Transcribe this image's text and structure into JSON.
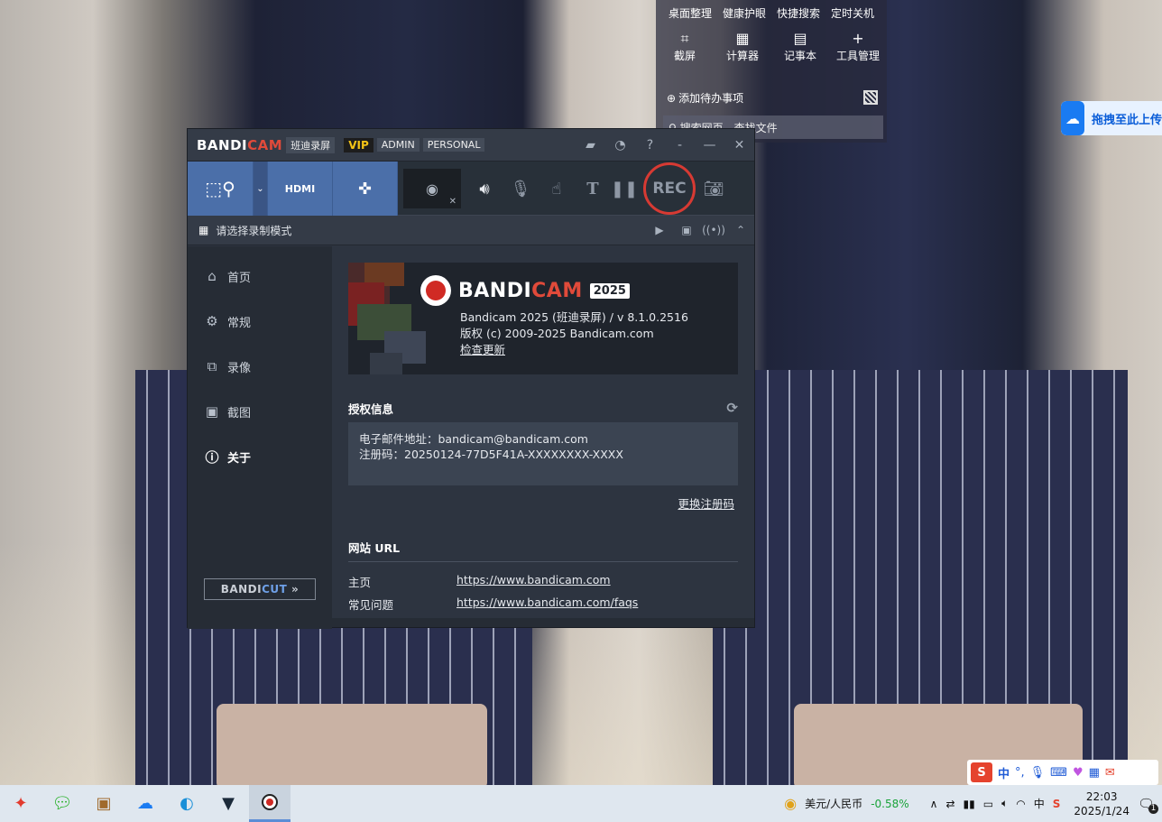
{
  "desktop_widget": {
    "top_links": [
      "桌面整理",
      "健康护眼",
      "快捷搜索",
      "定时关机"
    ],
    "tools": [
      {
        "icon": "crop-icon",
        "label": "截屏"
      },
      {
        "icon": "calculator-icon",
        "label": "计算器"
      },
      {
        "icon": "notepad-icon",
        "label": "记事本"
      },
      {
        "icon": "plus-icon",
        "label": "工具管理"
      }
    ],
    "todo_label": "添加待办事项",
    "search_label": "搜索网页、查找文件"
  },
  "cloud_button": {
    "label": "拖拽至此上传"
  },
  "bandicam": {
    "title": {
      "logo_a": "BANDI",
      "logo_b": "CAM",
      "subtitle": "班迪录屏",
      "vip": "VIP",
      "admin": "ADMIN",
      "personal": "PERSONAL"
    },
    "toolbar": {
      "rec_label": "REC"
    },
    "mode_bar": {
      "label": "请选择录制模式"
    },
    "nav": [
      {
        "icon": "home-icon",
        "label": "首页"
      },
      {
        "icon": "gear-icon",
        "label": "常规"
      },
      {
        "icon": "video-icon",
        "label": "录像"
      },
      {
        "icon": "image-icon",
        "label": "截图"
      },
      {
        "icon": "info-icon",
        "label": "关于"
      }
    ],
    "bandicut": {
      "a": "BANDI",
      "b": "CUT",
      "arrows": "»"
    },
    "about": {
      "brand_a": "BANDI",
      "brand_b": "CAM",
      "year": "2025",
      "version": "Bandicam 2025 (班迪录屏) / v 8.1.0.2516",
      "copyright": "版权 (c) 2009-2025 Bandicam.com",
      "check_update": "检查更新",
      "license_title": "授权信息",
      "email": "电子邮件地址：bandicam@bandicam.com",
      "serial": "注册码：20250124-77D5F41A-XXXXXXXX-XXXX",
      "change_serial": "更换注册码",
      "website_title": "网站 URL",
      "home_label": "主页",
      "home_url": "https://www.bandicam.com",
      "faq_label": "常见问题",
      "faq_url": "https://www.bandicam.com/faqs"
    }
  },
  "ime": {
    "lang": "中"
  },
  "taskbar": {
    "currency": "美元/人民币",
    "change": "-0.58%",
    "ime_lang": "中",
    "time": "22:03",
    "date": "2025/1/24",
    "notification_count": "1"
  }
}
